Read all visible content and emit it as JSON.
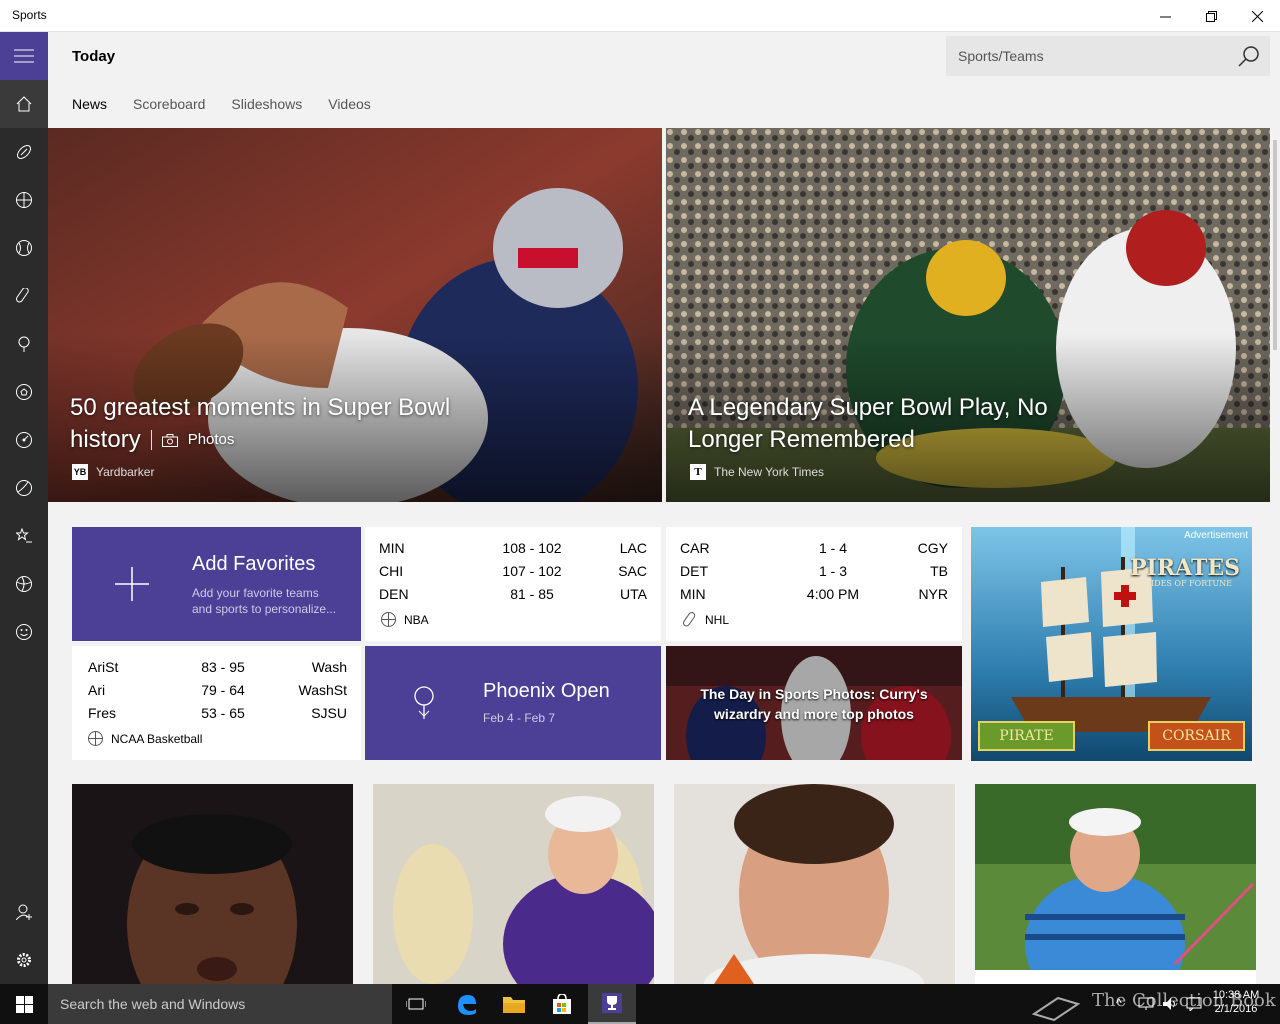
{
  "window": {
    "title": "Sports"
  },
  "header": {
    "title": "Today"
  },
  "search": {
    "placeholder": "Sports/Teams"
  },
  "tabs": [
    {
      "label": "News"
    },
    {
      "label": "Scoreboard"
    },
    {
      "label": "Slideshows"
    },
    {
      "label": "Videos"
    }
  ],
  "hero": [
    {
      "headline_line1": "50 greatest moments in Super Bowl",
      "headline_line2": "history",
      "badge": "Photos",
      "source": "Yardbarker",
      "source_logo": "YB"
    },
    {
      "headline_line1": "A Legendary Super Bowl Play, No",
      "headline_line2": "Longer Remembered",
      "source": "The New York Times",
      "source_logo": "T"
    }
  ],
  "favorites": {
    "title": "Add Favorites",
    "subtitle_line1": "Add your favorite teams",
    "subtitle_line2": "and sports to personalize..."
  },
  "nba": {
    "league": "NBA",
    "rows": [
      {
        "t1": "MIN",
        "score": "108  -  102",
        "t2": "LAC"
      },
      {
        "t1": "CHI",
        "score": "107  -  102",
        "t2": "SAC"
      },
      {
        "t1": "DEN",
        "score": "81  -  85",
        "t2": "UTA"
      }
    ]
  },
  "nhl": {
    "league": "NHL",
    "rows": [
      {
        "t1": "CAR",
        "score": "1  -  4",
        "t2": "CGY"
      },
      {
        "t1": "DET",
        "score": "1  -  3",
        "t2": "TB"
      },
      {
        "t1": "MIN",
        "score": "4:00 PM",
        "t2": "NYR"
      }
    ]
  },
  "ncaa": {
    "league": "NCAA Basketball",
    "rows": [
      {
        "t1": "AriSt",
        "score": "83  -  95",
        "t2": "Wash"
      },
      {
        "t1": "Ari",
        "score": "79  -  64",
        "t2": "WashSt"
      },
      {
        "t1": "Fres",
        "score": "53  -  65",
        "t2": "SJSU"
      }
    ]
  },
  "golf": {
    "title": "Phoenix Open",
    "dates": "Feb 4 - Feb 7"
  },
  "photos_tile": {
    "line1": "The Day in Sports Photos: Curry's",
    "line2": "wizardry and more top photos"
  },
  "ad": {
    "label": "Advertisement",
    "brand": "PIRATES",
    "tagline": "TIDES OF FORTUNE",
    "btn_left": "PIRATE",
    "btn_right": "CORSAIR"
  },
  "taskbar": {
    "search_placeholder": "Search the web and Windows",
    "time": "10:38 AM",
    "date": "2/1/2016",
    "watermark": "The Collection Book"
  },
  "colors": {
    "accent": "#4b3f96",
    "sidebar": "#2b2b2b"
  }
}
